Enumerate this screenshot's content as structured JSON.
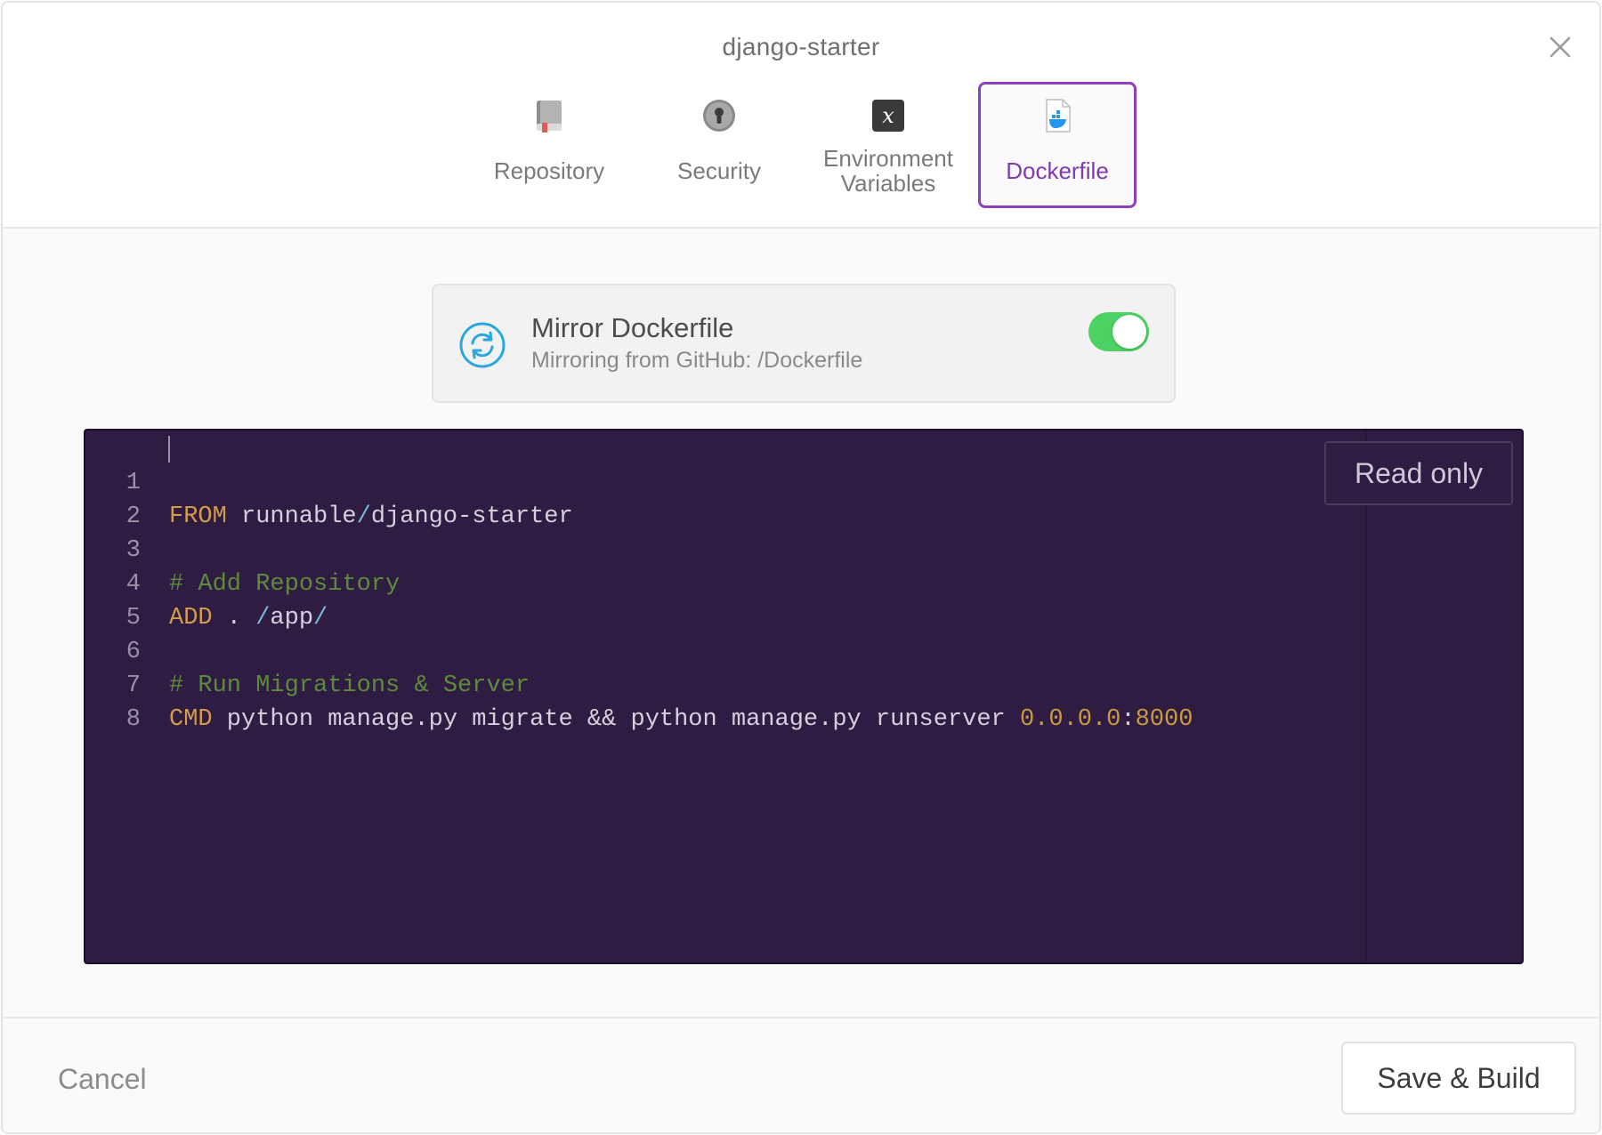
{
  "modal": {
    "title": "django-starter"
  },
  "tabs": [
    {
      "label": "Repository",
      "icon": "book-icon"
    },
    {
      "label": "Security",
      "icon": "keyhole-icon"
    },
    {
      "label": "Environment\nVariables",
      "label_line1": "Environment",
      "label_line2": "Variables",
      "icon": "variable-x-icon"
    },
    {
      "label": "Dockerfile",
      "icon": "dockerfile-icon",
      "active": true
    }
  ],
  "mirror": {
    "title": "Mirror Dockerfile",
    "subtitle": "Mirroring from GitHub: /Dockerfile",
    "enabled": true
  },
  "editor": {
    "read_only_label": "Read only",
    "lines": [
      {
        "n": "1",
        "text": "FROM runnable/django-starter"
      },
      {
        "n": "2",
        "text": ""
      },
      {
        "n": "3",
        "text": "# Add Repository"
      },
      {
        "n": "4",
        "text": "ADD . /app/"
      },
      {
        "n": "5",
        "text": ""
      },
      {
        "n": "6",
        "text": "# Run Migrations & Server"
      },
      {
        "n": "7",
        "text": "CMD python manage.py migrate && python manage.py runserver 0.0.0.0:8000"
      },
      {
        "n": "8",
        "text": ""
      }
    ]
  },
  "footer": {
    "cancel_label": "Cancel",
    "save_label": "Save & Build"
  },
  "colors": {
    "accent": "#8e3fbf",
    "toggle_on": "#4cd263",
    "editor_bg": "#2f1c42",
    "keyword": "#d29c4a",
    "comment": "#5f8a3c"
  }
}
